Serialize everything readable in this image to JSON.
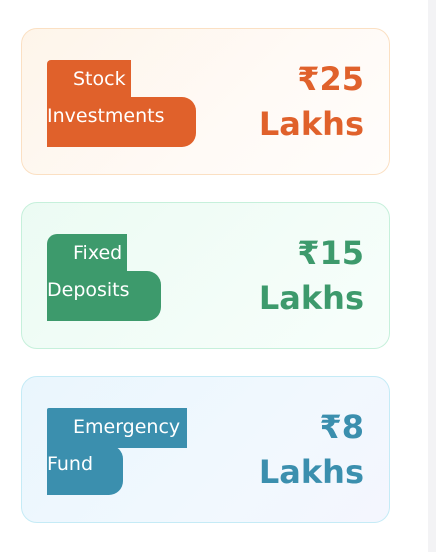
{
  "cards": [
    {
      "label_line1": "Stock",
      "label_line2": "Investments",
      "amount": "₹25",
      "unit": "Lakhs",
      "color": "#e0612b"
    },
    {
      "label_line1": "Fixed",
      "label_line2": "Deposits",
      "amount": "₹15",
      "unit": "Lakhs",
      "color": "#3d9a6c"
    },
    {
      "label_line1": "Emergency",
      "label_line2": "Fund",
      "amount": "₹8",
      "unit": "Lakhs",
      "color": "#3b8fae"
    }
  ]
}
